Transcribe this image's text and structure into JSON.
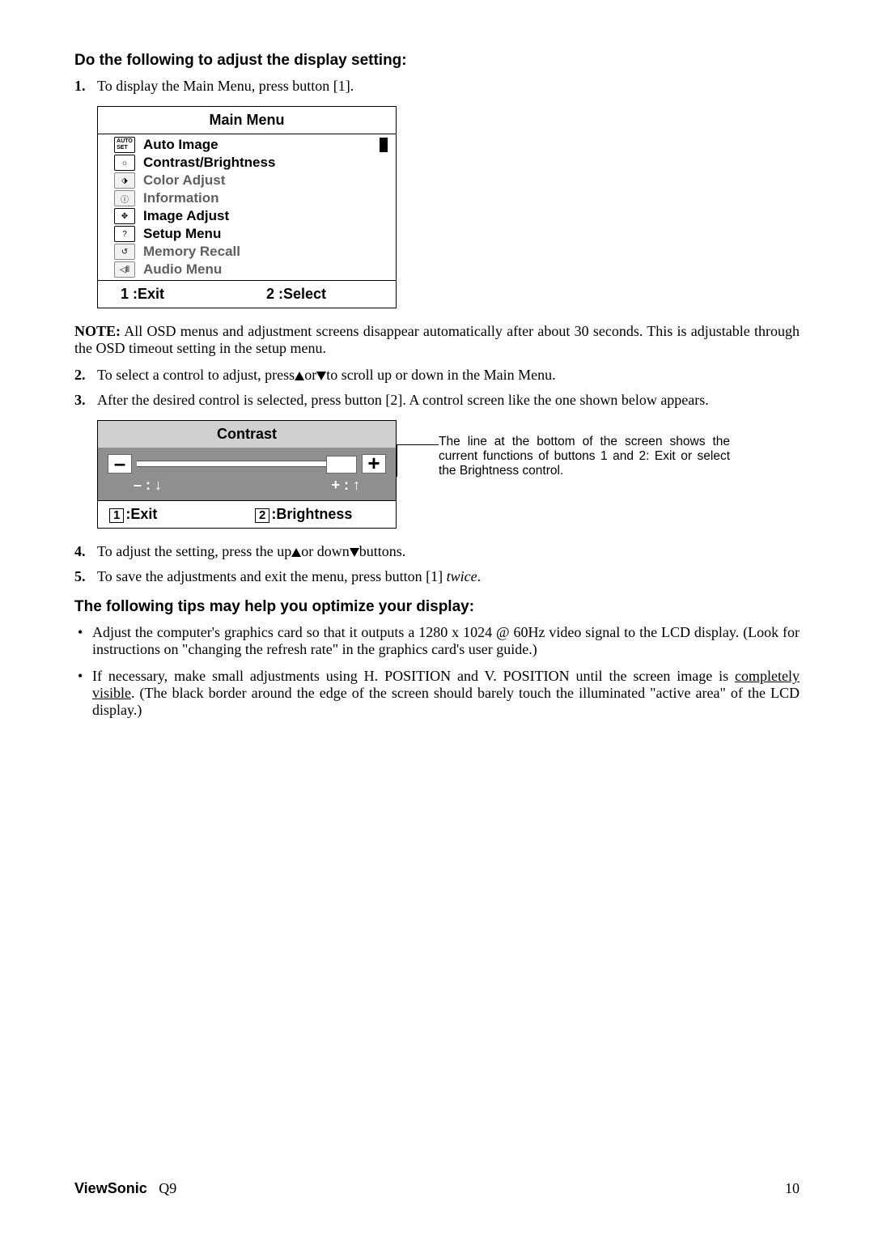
{
  "heading1": "Do the following to adjust the display setting:",
  "step1_num": "1.",
  "step1": "To display the Main Menu, press button [1].",
  "main_menu": {
    "title": "Main Menu",
    "items": [
      {
        "icon": "AUTO SET",
        "label": "Auto Image",
        "highlight": true,
        "selected": true
      },
      {
        "icon": "☼",
        "label": "Contrast/Brightness",
        "highlight": true
      },
      {
        "icon": "⬗",
        "label": "Color Adjust"
      },
      {
        "icon": "ⓘ",
        "label": "Information"
      },
      {
        "icon": "✥",
        "label": "Image Adjust",
        "highlight": true
      },
      {
        "icon": "?",
        "label": "Setup Menu",
        "highlight": true
      },
      {
        "icon": "↺",
        "label": "Memory Recall"
      },
      {
        "icon": "◁⦀",
        "label": "Audio Menu"
      }
    ],
    "footer_left": "1 :Exit",
    "footer_right": "2 :Select"
  },
  "note_label": "NOTE:",
  "note_text": " All OSD menus and adjustment screens disappear automatically after about 30 seconds. This is adjustable through the OSD timeout setting in the setup menu.",
  "step2_num": "2.",
  "step2_a": "To select a control to adjust, press",
  "step2_b": "or",
  "step2_c": "to scroll up or down in the Main Menu.",
  "step3_num": "3.",
  "step3": "After the desired control is selected, press button [2]. A control screen like the one shown below appears.",
  "contrast": {
    "title": "Contrast",
    "arrow_left": "– : ↓",
    "arrow_right": "+ : ↑",
    "footer_left": ":Exit",
    "footer_left_key": "1",
    "footer_right": ":Brightness",
    "footer_right_key": "2"
  },
  "callout": "The line at the bottom of the screen shows the current functions of buttons 1 and 2:  Exit or select the Brightness control.",
  "step4_num": "4.",
  "step4_a": "To adjust the setting, press the up",
  "step4_b": "or down",
  "step4_c": "buttons.",
  "step5_num": "5.",
  "step5_a": "To save the adjustments and exit the menu, press button [1] ",
  "step5_b": "twice",
  "step5_c": ".",
  "heading2": "The following tips may help you optimize your display:",
  "tip1": "Adjust the computer's graphics card so that it outputs a 1280 x 1024 @ 60Hz video signal to the LCD display. (Look for instructions on \"changing the refresh rate\" in the graphics card's user guide.)",
  "tip2_a": "If necessary, make small adjustments using H. POSITION and V. POSITION until the screen image is ",
  "tip2_b": "completely visible",
  "tip2_c": ". (The black border around the edge of the screen should barely touch the illuminated \"active area\" of the LCD display.)",
  "footer_brand": "ViewSonic",
  "footer_model": "Q9",
  "footer_page": "10"
}
